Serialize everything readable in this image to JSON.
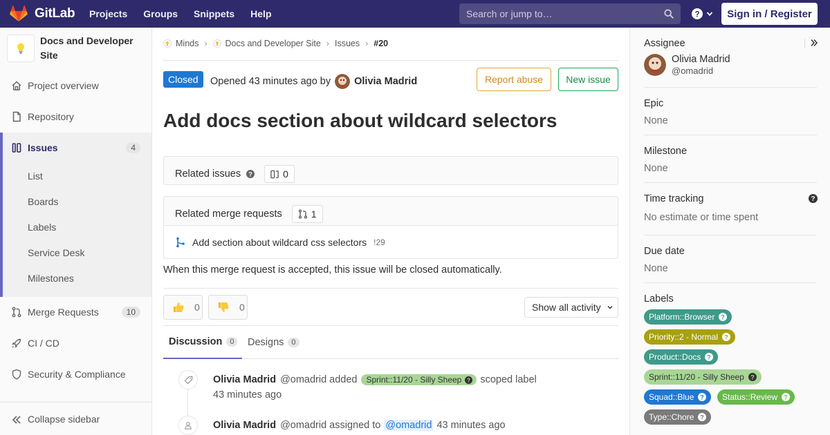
{
  "nav": {
    "brand": "GitLab",
    "links": [
      "Projects",
      "Groups",
      "Snippets",
      "Help"
    ],
    "search_placeholder": "Search or jump to…",
    "signin": "Sign in / Register"
  },
  "sidebar": {
    "project_name": "Docs and Developer Site",
    "items": [
      {
        "label": "Project overview",
        "icon": "home-icon"
      },
      {
        "label": "Repository",
        "icon": "doc-icon"
      },
      {
        "label": "Issues",
        "icon": "issues-icon",
        "count": "4"
      },
      {
        "label": "Merge Requests",
        "icon": "merge-request-icon",
        "count": "10"
      },
      {
        "label": "CI / CD",
        "icon": "rocket-icon"
      },
      {
        "label": "Security & Compliance",
        "icon": "shield-icon"
      }
    ],
    "sub_items": [
      "List",
      "Boards",
      "Labels",
      "Service Desk",
      "Milestones"
    ],
    "collapse": "Collapse sidebar"
  },
  "breadcrumbs": {
    "items": [
      "Minds",
      "Docs and Developer Site",
      "Issues"
    ],
    "current": "#20"
  },
  "issue": {
    "status": "Closed",
    "opened_text": "Opened 43 minutes ago by",
    "author": "Olivia Madrid",
    "report_abuse": "Report abuse",
    "new_issue": "New issue",
    "title": "Add docs section about wildcard selectors"
  },
  "related_issues": {
    "title": "Related issues",
    "count": "0"
  },
  "related_mrs": {
    "title": "Related merge requests",
    "count": "1",
    "mr_title": "Add section about wildcard css selectors",
    "mr_ref": "!29",
    "note": "When this merge request is accepted, this issue will be closed automatically."
  },
  "awards": {
    "thumbs_up": "0",
    "thumbs_down": "0",
    "activity_filter": "Show all activity"
  },
  "tabs": {
    "discussion": "Discussion",
    "discussion_count": "0",
    "designs": "Designs",
    "designs_count": "0"
  },
  "timeline": [
    {
      "author": "Olivia Madrid",
      "handle": "@omadrid",
      "action": "added",
      "label": "Sprint::11/20 - Silly Sheep",
      "suffix": "scoped label",
      "time": "43 minutes ago"
    },
    {
      "author": "Olivia Madrid",
      "handle": "@omadrid",
      "action": "assigned to",
      "mention": "@omadrid",
      "time": "43 minutes ago"
    }
  ],
  "right_sidebar": {
    "assignee_label": "Assignee",
    "assignee_name": "Olivia Madrid",
    "assignee_handle": "@omadrid",
    "epic_label": "Epic",
    "epic_value": "None",
    "milestone_label": "Milestone",
    "milestone_value": "None",
    "time_label": "Time tracking",
    "time_value": "No estimate or time spent",
    "due_label": "Due date",
    "due_value": "None",
    "labels_label": "Labels",
    "labels": [
      {
        "text": "Platform::Browser",
        "color": "#3e9a8a"
      },
      {
        "text": "Priority::2 - Normal",
        "color": "#a8a10e"
      },
      {
        "text": "Product::Docs",
        "color": "#3e9a8a"
      },
      {
        "text": "Sprint::11/20 - Silly Sheep",
        "color": "#a8d695"
      },
      {
        "text": "Squad::Blue",
        "color": "#1f78d1"
      },
      {
        "text": "Status::Review",
        "color": "#69b84e"
      },
      {
        "text": "Type::Chore",
        "color": "#7a7a7a"
      }
    ]
  },
  "colors": {
    "navbar": "#2f2a6b",
    "active_accent": "#6666c4",
    "closed_badge": "#1f78d1",
    "abuse_border": "#e9a235",
    "new_issue_border": "#1aaa55"
  }
}
